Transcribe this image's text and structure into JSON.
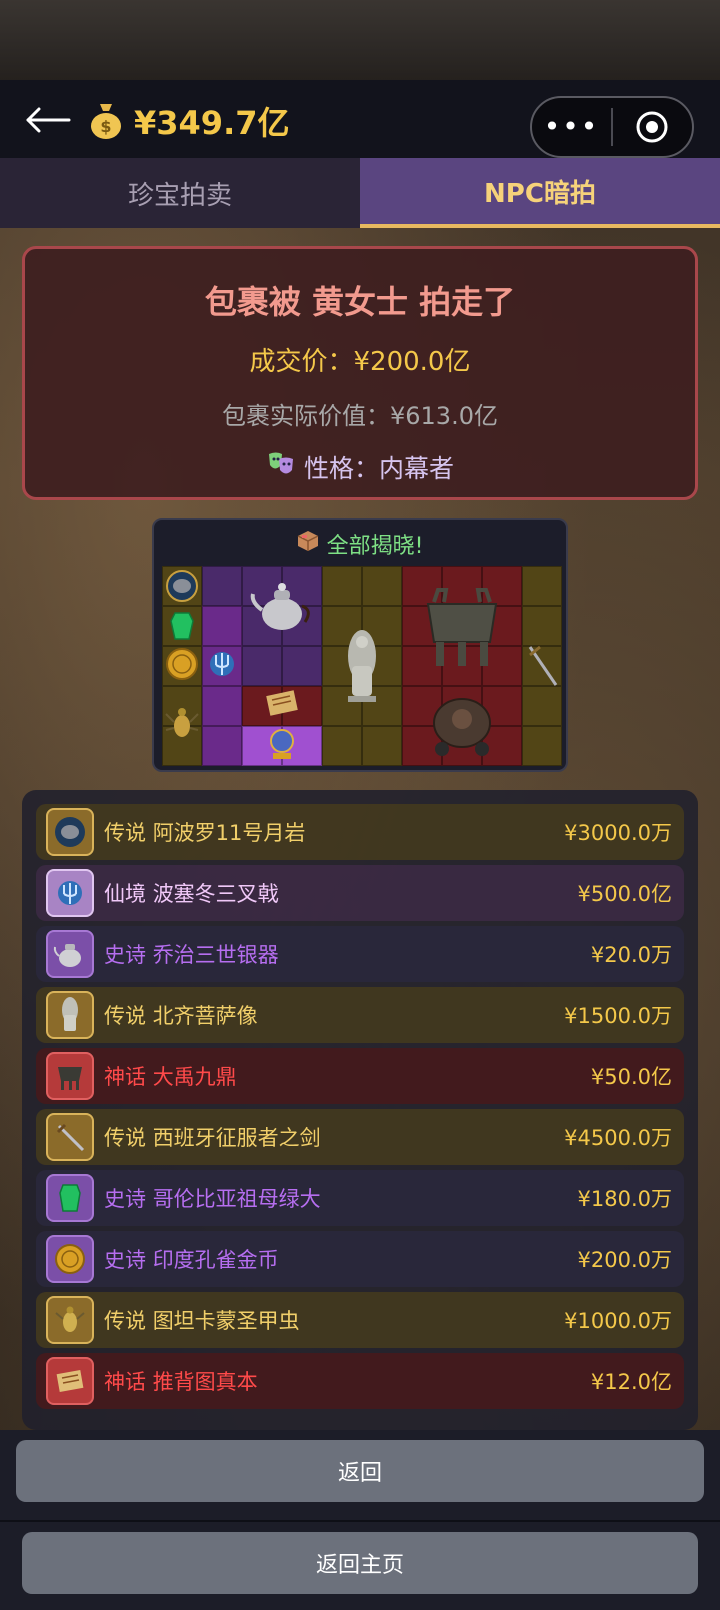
{
  "header": {
    "money": "¥349.7亿",
    "back_icon": "back-arrow-icon",
    "coin_icon": "money-bag-icon",
    "menu_more": "•••",
    "menu_record_icon": "record-circle-icon"
  },
  "tabs": [
    {
      "label": "珍宝拍卖",
      "active": false
    },
    {
      "label": "NPC暗拍",
      "active": true
    }
  ],
  "result": {
    "title": "包裹被 黄女士 拍走了",
    "price": "成交价：¥200.0亿",
    "actual_value": "包裹实际价值：¥613.0亿",
    "trait_icon": "theater-masks-icon",
    "trait": "性格：内幕者"
  },
  "grid": {
    "title_icon": "package-icon",
    "title": "全部揭晓!"
  },
  "items": [
    {
      "rarity": "传说",
      "name": "阿波罗11号月岩",
      "price": "¥3000.0万",
      "tier": "legend",
      "icon": "moon-rock-icon"
    },
    {
      "rarity": "仙境",
      "name": "波塞冬三叉戟",
      "price": "¥500.0亿",
      "tier": "fairy",
      "icon": "trident-icon"
    },
    {
      "rarity": "史诗",
      "name": "乔治三世银器",
      "price": "¥20.0万",
      "tier": "epic",
      "icon": "silver-teapot-icon"
    },
    {
      "rarity": "传说",
      "name": "北齐菩萨像",
      "price": "¥1500.0万",
      "tier": "legend",
      "icon": "bodhisattva-statue-icon"
    },
    {
      "rarity": "神话",
      "name": "大禹九鼎",
      "price": "¥50.0亿",
      "tier": "myth",
      "icon": "bronze-ding-icon"
    },
    {
      "rarity": "传说",
      "name": "西班牙征服者之剑",
      "price": "¥4500.0万",
      "tier": "legend",
      "icon": "sword-icon"
    },
    {
      "rarity": "史诗",
      "name": "哥伦比亚祖母绿大",
      "price": "¥180.0万",
      "tier": "epic",
      "icon": "emerald-icon"
    },
    {
      "rarity": "史诗",
      "name": "印度孔雀金币",
      "price": "¥200.0万",
      "tier": "epic",
      "icon": "gold-coin-icon"
    },
    {
      "rarity": "传说",
      "name": "图坦卡蒙圣甲虫",
      "price": "¥1000.0万",
      "tier": "legend",
      "icon": "scarab-icon"
    },
    {
      "rarity": "神话",
      "name": "推背图真本",
      "price": "¥12.0亿",
      "tier": "myth",
      "icon": "scroll-icon"
    }
  ],
  "buttons": {
    "back": "返回",
    "home": "返回主页"
  }
}
